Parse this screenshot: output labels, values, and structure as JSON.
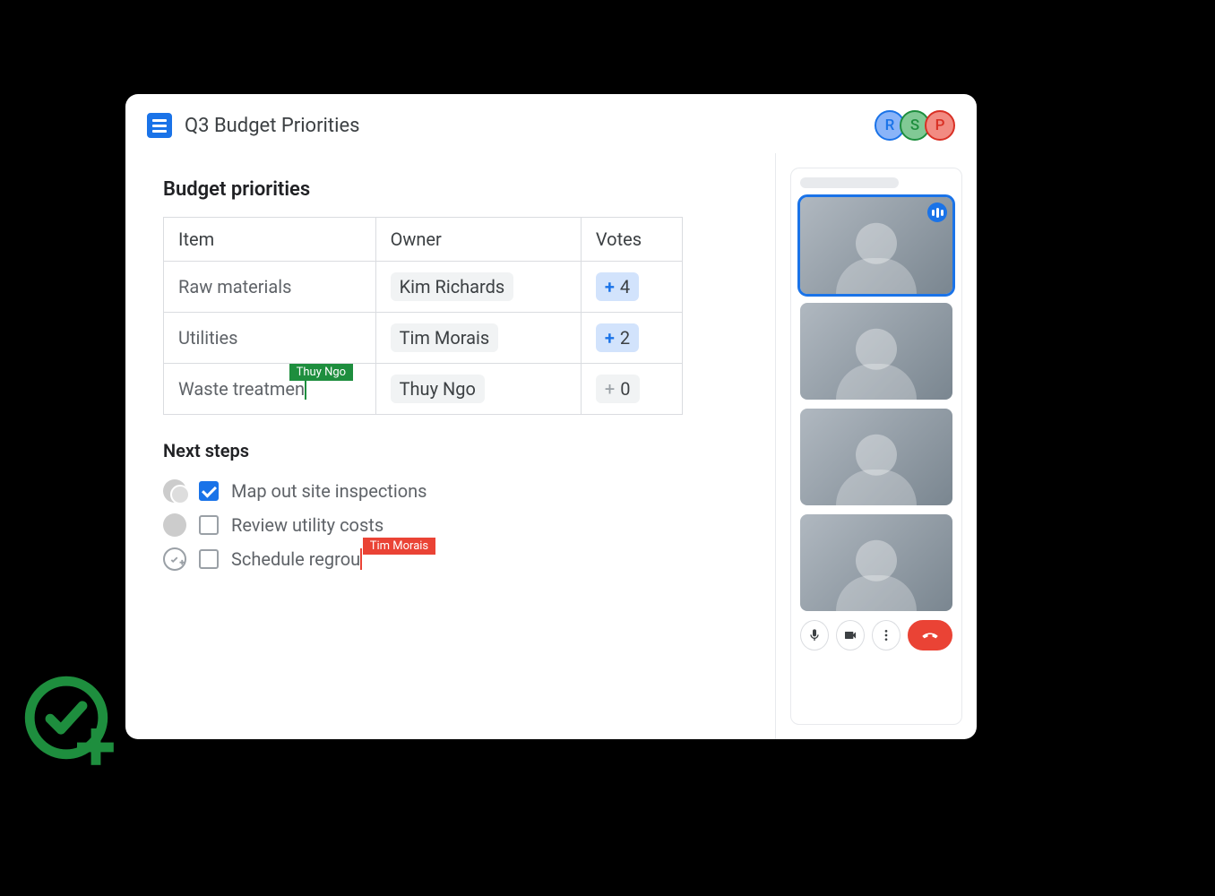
{
  "header": {
    "doc_title": "Q3 Budget Priorities",
    "collaborators": [
      {
        "initial": "R",
        "cls": "av-r"
      },
      {
        "initial": "S",
        "cls": "av-s"
      },
      {
        "initial": "P",
        "cls": "av-p"
      }
    ]
  },
  "section_title": "Budget priorities",
  "table": {
    "headers": {
      "item": "Item",
      "owner": "Owner",
      "votes": "Votes"
    },
    "rows": [
      {
        "item": "Raw materials",
        "owner": "Kim Richards",
        "votes": "4",
        "active": true
      },
      {
        "item": "Utilities",
        "owner": "Tim Morais",
        "votes": "2",
        "active": true
      },
      {
        "item": "Waste treatmen",
        "owner": "Thuy Ngo",
        "votes": "0",
        "active": false,
        "cursor_user": "Thuy Ngo"
      }
    ]
  },
  "next_steps": {
    "title": "Next steps",
    "items": [
      {
        "text": "Map out site inspections",
        "checked": true,
        "assignee_type": "multi"
      },
      {
        "text": "Review utility costs",
        "checked": false,
        "assignee_type": "single"
      },
      {
        "text": "Schedule regrou",
        "checked": false,
        "assignee_type": "add",
        "cursor_user": "Tim Morais"
      }
    ]
  },
  "meet": {
    "participants": 4,
    "speaking_index": 0
  }
}
